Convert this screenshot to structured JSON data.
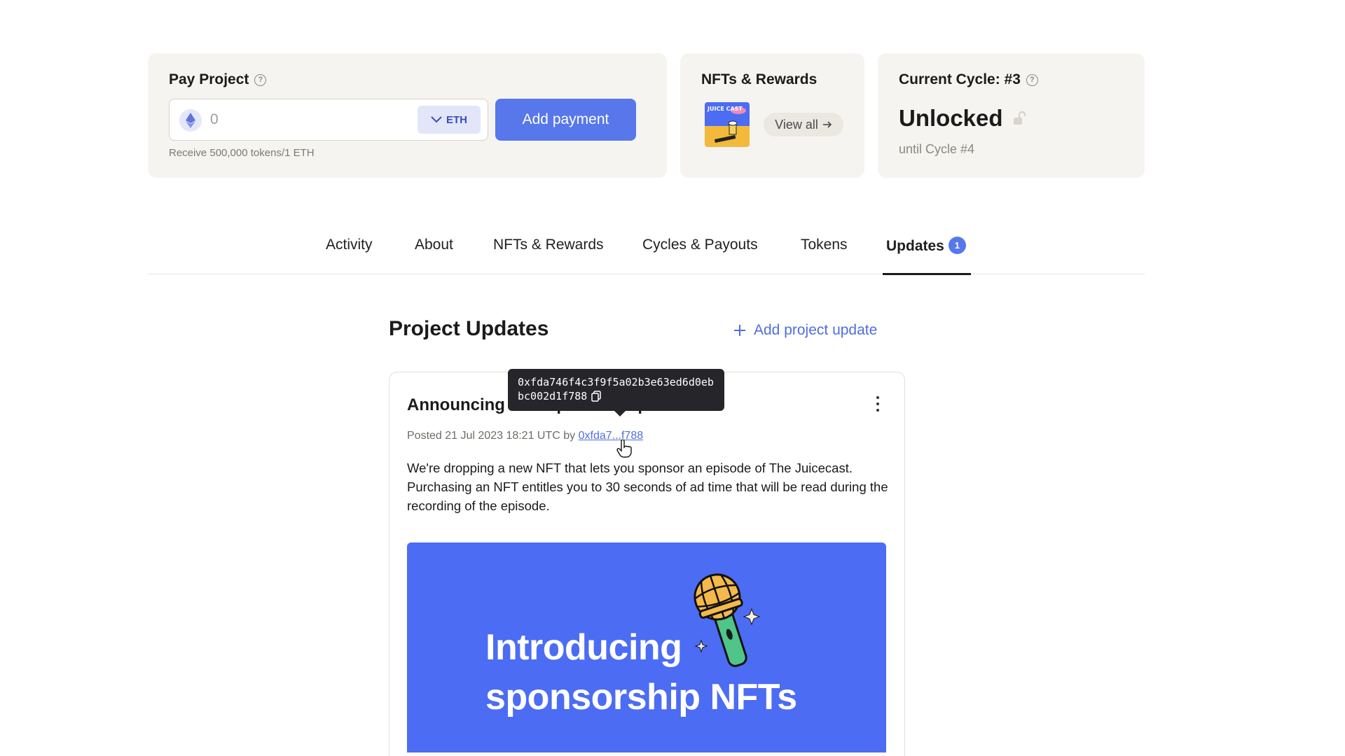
{
  "pay_project": {
    "title": "Pay Project",
    "amount_value": "0",
    "currency": "ETH",
    "add_payment_label": "Add payment",
    "hint": "Receive 500,000 tokens/1 ETH"
  },
  "nfts_rewards": {
    "title": "NFTs & Rewards",
    "thumb_text": "JUICE CAST",
    "view_all_label": "View all"
  },
  "current_cycle": {
    "title": "Current Cycle: #3",
    "status": "Unlocked",
    "until": "until Cycle #4"
  },
  "tabs": [
    {
      "label": "Activity"
    },
    {
      "label": "About"
    },
    {
      "label": "NFTs & Rewards"
    },
    {
      "label": "Cycles & Payouts"
    },
    {
      "label": "Tokens"
    },
    {
      "label": "Updates",
      "badge": "1",
      "active": true
    }
  ],
  "updates": {
    "section_title": "Project Updates",
    "add_update_label": "Add project update"
  },
  "post": {
    "title": "Announcing new sponsorship NFT",
    "meta_prefix": "Posted 21 Jul 2023 18:21 UTC by ",
    "author_short": "0xfda7...f788",
    "body": "We're dropping a new NFT that lets you sponsor an episode of The Juicecast. Purchasing an NFT entitles you to 30 seconds of ad time that will be read during the recording of the episode.",
    "banner_line1": "Introducing",
    "banner_line2": "sponsorship NFTs"
  },
  "tooltip": {
    "address_line1": "0xfda746f4c3f9f5a02b3e63ed6d0eb",
    "address_line2": "bc002d1f788"
  },
  "colors": {
    "accent": "#5777eb",
    "card_bg": "#f6f4f0",
    "banner_bg": "#4c6cf3"
  }
}
